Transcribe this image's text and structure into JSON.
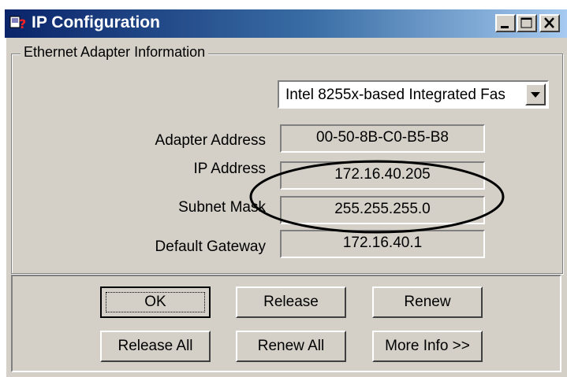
{
  "window": {
    "title": "IP Configuration",
    "title_icon": "ip-config-icon",
    "controls": [
      "minimize",
      "maximize",
      "close"
    ]
  },
  "adapter_group": {
    "label": "Ethernet  Adapter Information",
    "adapter_select": {
      "value": "Intel 8255x-based Integrated Fas"
    },
    "fields": [
      {
        "label": "Adapter Address",
        "value": "00-50-8B-C0-B5-B8"
      },
      {
        "label": "IP Address",
        "value": "172.16.40.205"
      },
      {
        "label": "Subnet Mask",
        "value": "255.255.255.0"
      },
      {
        "label": "Default Gateway",
        "value": "172.16.40.1"
      }
    ]
  },
  "buttons": {
    "ok": "OK",
    "release": "Release",
    "renew": "Renew",
    "release_all": "Release All",
    "renew_all": "Renew All",
    "more_info": "More Info >>"
  },
  "colors": {
    "titlebar_start": "#0a246a",
    "titlebar_end": "#a6caf0",
    "face": "#d4d0c8"
  }
}
